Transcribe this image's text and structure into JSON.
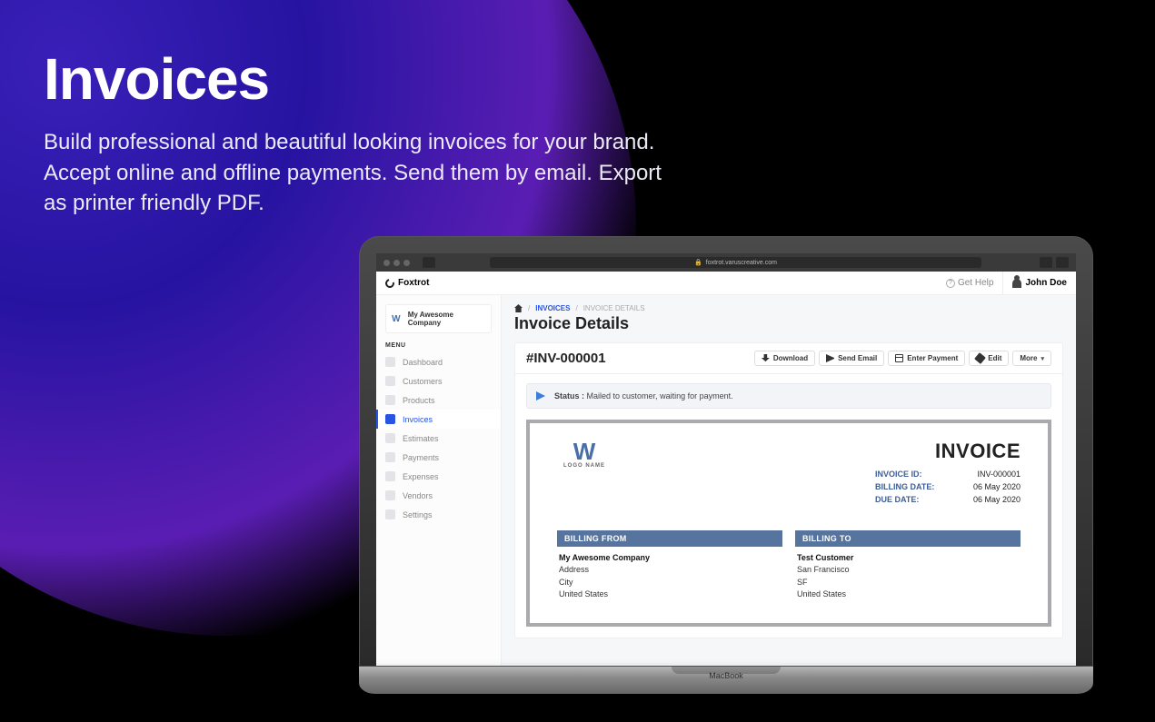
{
  "hero": {
    "title": "Invoices",
    "subtitle": "Build professional and beautiful looking invoices for your brand. Accept online and offline payments. Send them by email. Export as printer friendly PDF."
  },
  "browser": {
    "url": "foxtrot.varuscreative.com"
  },
  "app": {
    "name": "Foxtrot",
    "help": "Get Help",
    "user": "John Doe",
    "company": "My Awesome Company"
  },
  "sidebar": {
    "menu_label": "MENU",
    "items": [
      {
        "label": "Dashboard"
      },
      {
        "label": "Customers"
      },
      {
        "label": "Products"
      },
      {
        "label": "Invoices"
      },
      {
        "label": "Estimates"
      },
      {
        "label": "Payments"
      },
      {
        "label": "Expenses"
      },
      {
        "label": "Vendors"
      },
      {
        "label": "Settings"
      }
    ]
  },
  "breadcrumb": {
    "section": "INVOICES",
    "current": "INVOICE DETAILS"
  },
  "page_title": "Invoice Details",
  "invoice": {
    "display_id": "#INV-000001",
    "actions": {
      "download": "Download",
      "send": "Send Email",
      "payment": "Enter Payment",
      "edit": "Edit",
      "more": "More"
    },
    "status_label": "Status :",
    "status_text": "Mailed to customer, waiting for payment.",
    "doc": {
      "logo_name": "LOGO NAME",
      "heading": "INVOICE",
      "meta": {
        "id_label": "INVOICE ID:",
        "id_value": "INV-000001",
        "bill_date_label": "BILLING DATE:",
        "bill_date_value": "06 May 2020",
        "due_date_label": "DUE DATE:",
        "due_date_value": "06 May 2020"
      },
      "from": {
        "heading": "BILLING FROM",
        "name": "My Awesome Company",
        "line1": "Address",
        "line2": "City",
        "line3": "United States"
      },
      "to": {
        "heading": "BILLING TO",
        "name": "Test Customer",
        "line1": "San Francisco",
        "line2": "SF",
        "line3": "United States"
      }
    }
  },
  "laptop_label": "MacBook"
}
